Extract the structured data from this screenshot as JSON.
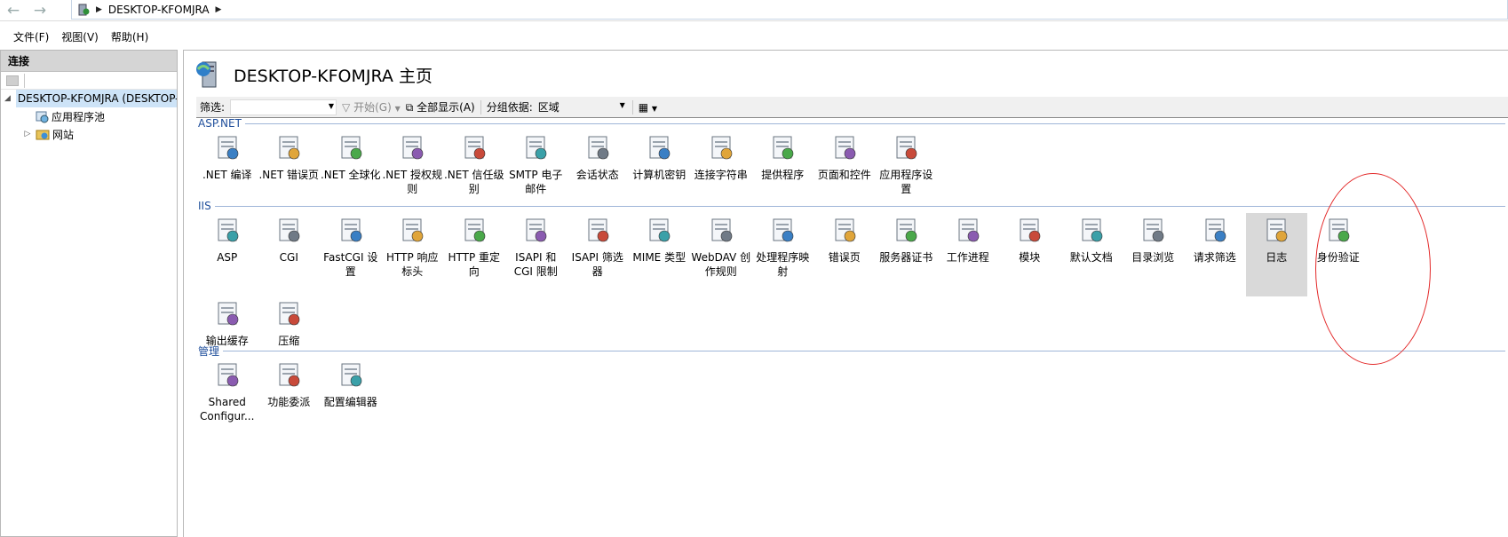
{
  "address": {
    "path": "DESKTOP-KFOMJRA"
  },
  "menu": [
    {
      "label": "文件(F)"
    },
    {
      "label": "视图(V)"
    },
    {
      "label": "帮助(H)"
    }
  ],
  "left": {
    "header": "连接",
    "tree": [
      {
        "label": "DESKTOP-KFOMJRA (DESKTOP-KFOMJRA\\",
        "level": 0,
        "expanded": true
      },
      {
        "label": "应用程序池",
        "level": 1
      },
      {
        "label": "网站",
        "level": 1,
        "expanded": false
      }
    ]
  },
  "main": {
    "title": "DESKTOP-KFOMJRA 主页",
    "filter": {
      "label": "筛选:",
      "value": "",
      "start": "开始(G)",
      "show_all": "全部显示(A)",
      "group_label": "分组依据:",
      "group_value": "区域"
    },
    "sections": [
      {
        "name": "ASP.NET",
        "items": [
          {
            "label": ".NET 编译",
            "icon": "net-compile-icon"
          },
          {
            "label": ".NET 错误页",
            "icon": "net-error-page-icon"
          },
          {
            "label": ".NET 全球化",
            "icon": "globe-icon"
          },
          {
            "label": ".NET 授权规则",
            "icon": "auth-rules-icon"
          },
          {
            "label": ".NET 信任级别",
            "icon": "trust-level-icon"
          },
          {
            "label": "SMTP 电子邮件",
            "icon": "smtp-icon"
          },
          {
            "label": "会话状态",
            "icon": "session-state-icon"
          },
          {
            "label": "计算机密钥",
            "icon": "machine-key-icon"
          },
          {
            "label": "连接字符串",
            "icon": "connection-string-icon"
          },
          {
            "label": "提供程序",
            "icon": "providers-icon"
          },
          {
            "label": "页面和控件",
            "icon": "pages-controls-icon"
          },
          {
            "label": "应用程序设置",
            "icon": "app-settings-icon"
          }
        ]
      },
      {
        "name": "IIS",
        "items": [
          {
            "label": "ASP",
            "icon": "asp-icon"
          },
          {
            "label": "CGI",
            "icon": "cgi-icon"
          },
          {
            "label": "FastCGI 设置",
            "icon": "fastcgi-icon"
          },
          {
            "label": "HTTP 响应标头",
            "icon": "http-headers-icon"
          },
          {
            "label": "HTTP 重定向",
            "icon": "http-redirect-icon"
          },
          {
            "label": "ISAPI 和 CGI 限制",
            "icon": "isapi-cgi-icon"
          },
          {
            "label": "ISAPI 筛选器",
            "icon": "isapi-filter-icon"
          },
          {
            "label": "MIME 类型",
            "icon": "mime-icon"
          },
          {
            "label": "WebDAV 创作规则",
            "icon": "webdav-icon"
          },
          {
            "label": "处理程序映射",
            "icon": "handler-mapping-icon"
          },
          {
            "label": "错误页",
            "icon": "error-page-icon"
          },
          {
            "label": "服务器证书",
            "icon": "certificate-icon"
          },
          {
            "label": "工作进程",
            "icon": "worker-process-icon"
          },
          {
            "label": "模块",
            "icon": "modules-icon"
          },
          {
            "label": "默认文档",
            "icon": "default-doc-icon"
          },
          {
            "label": "目录浏览",
            "icon": "directory-browse-icon"
          },
          {
            "label": "请求筛选",
            "icon": "request-filter-icon"
          },
          {
            "label": "日志",
            "icon": "logging-icon",
            "selected": true
          },
          {
            "label": "身份验证",
            "icon": "authentication-icon"
          },
          {
            "label": "输出缓存",
            "icon": "output-cache-icon"
          },
          {
            "label": "压缩",
            "icon": "compression-icon"
          }
        ]
      },
      {
        "name": "管理",
        "items": [
          {
            "label": "Shared Configur...",
            "icon": "shared-config-icon"
          },
          {
            "label": "功能委派",
            "icon": "delegation-icon"
          },
          {
            "label": "配置编辑器",
            "icon": "config-editor-icon"
          }
        ]
      }
    ]
  },
  "colors": {
    "selected_item": "#d9d9d9",
    "section_label": "#1f4e9b",
    "annotation_circle": "#e32a2a"
  }
}
